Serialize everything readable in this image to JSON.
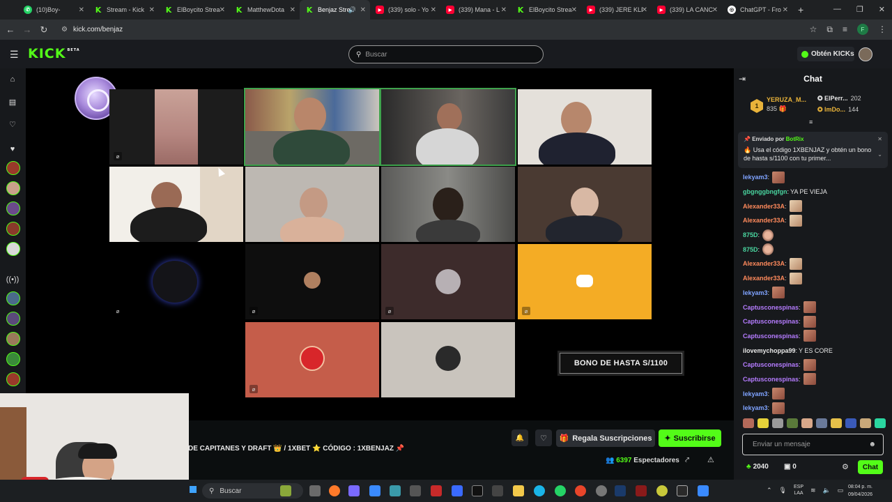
{
  "browser": {
    "tabs": [
      {
        "title": "(10)Boy-",
        "favicon": "whatsapp-icon",
        "active": false
      },
      {
        "title": "Stream - Kick",
        "favicon": "kick-icon",
        "active": false
      },
      {
        "title": "ElBoycito Strea",
        "favicon": "kick-icon",
        "active": false
      },
      {
        "title": "MatthewDota",
        "favicon": "kick-icon",
        "active": false
      },
      {
        "title": "Benjaz Stre",
        "favicon": "kick-icon",
        "active": true
      },
      {
        "title": "(339) solo - Yo",
        "favicon": "youtube-icon",
        "active": false
      },
      {
        "title": "(339) Mana - L",
        "favicon": "youtube-icon",
        "active": false
      },
      {
        "title": "ElBoycito Strea",
        "favicon": "kick-icon",
        "active": false
      },
      {
        "title": "(339) JERE KLE",
        "favicon": "youtube-icon",
        "active": false
      },
      {
        "title": "(339) LA CANC",
        "favicon": "youtube-icon",
        "active": false
      },
      {
        "title": "ChatGPT - Fro",
        "favicon": "chatgpt-icon",
        "active": false
      }
    ],
    "url": "kick.com/benjaz",
    "profile_initial": "F"
  },
  "kick": {
    "logo": "KICK",
    "logo_tag": "BETA",
    "search_placeholder": "Buscar",
    "kicks_button": "Obtén KICKs"
  },
  "stream": {
    "title": "DE CAPITANES Y DRAFT 👑 / 1XBET ⭐ CÓDIGO : 1XBENJAZ 📌",
    "overlay_banner": "BONO DE HASTA S/1100",
    "gift_button": "Regala Suscripciones",
    "subscribe_button": "Suscribirse",
    "viewers_count": "6397",
    "viewers_label": "Espectadores"
  },
  "chat": {
    "header": "Chat",
    "leaderboard": [
      {
        "rank": "1",
        "name": "YERUZA_M...",
        "points": "835"
      },
      {
        "name": "ElPerr...",
        "points": "202",
        "color": "#e8e8e8"
      },
      {
        "name": "ImDo...",
        "points": "144",
        "color": "#e9b33a"
      }
    ],
    "pinned": {
      "label": "Enviado por",
      "sender": "BotRix",
      "text": "🔥 Usa el código 1XBENJAZ y obtén un bono de hasta s/1100 con tu primer..."
    },
    "messages": [
      {
        "user": "lekyam3",
        "color": "#7fa3ff",
        "text": "",
        "emote": "face"
      },
      {
        "user": "gbgnggbngfgn",
        "color": "#4ad6a0",
        "text": "YA PE VIEJA",
        "emote": ""
      },
      {
        "user": "Alexander33A",
        "color": "#ff8a5c",
        "text": "",
        "emote": "cat"
      },
      {
        "user": "Alexander33A",
        "color": "#ff8a5c",
        "text": "",
        "emote": "cat"
      },
      {
        "user": "875D",
        "color": "#4ad6a0",
        "text": "",
        "emote": "kid"
      },
      {
        "user": "875D",
        "color": "#4ad6a0",
        "text": "",
        "emote": "kid"
      },
      {
        "user": "Alexander33A",
        "color": "#ff8a5c",
        "text": "",
        "emote": "cat"
      },
      {
        "user": "Alexander33A",
        "color": "#ff8a5c",
        "text": "",
        "emote": "cat"
      },
      {
        "user": "lekyam3",
        "color": "#7fa3ff",
        "text": "",
        "emote": "face"
      },
      {
        "user": "Captusconespinas",
        "color": "#b57cff",
        "text": "",
        "emote": "face"
      },
      {
        "user": "Captusconespinas",
        "color": "#b57cff",
        "text": "",
        "emote": "face"
      },
      {
        "user": "Captusconespinas",
        "color": "#b57cff",
        "text": "",
        "emote": "face"
      },
      {
        "user": "ilovemychoppa99",
        "color": "#e8e8e8",
        "text": "Y ES CORE",
        "emote": ""
      },
      {
        "user": "Captusconespinas",
        "color": "#b57cff",
        "text": "",
        "emote": "face"
      },
      {
        "user": "Captusconespinas",
        "color": "#b57cff",
        "text": "",
        "emote": "face"
      },
      {
        "user": "lekyam3",
        "color": "#7fa3ff",
        "text": "",
        "emote": "face"
      },
      {
        "user": "lekyam3",
        "color": "#7fa3ff",
        "text": "",
        "emote": "face"
      }
    ],
    "input_placeholder": "Enviar un mensaje",
    "kicks_balance": "2040",
    "subs_balance": "0",
    "send_button": "Chat"
  },
  "taskbar": {
    "search_placeholder": "Buscar",
    "lang_top": "ESP",
    "lang_bottom": "LAA",
    "time": "08:04 p. m.",
    "date": "09/04/2026"
  },
  "colors": {
    "kick_green": "#53fc18",
    "background": "#0b0e0f",
    "panel": "#17191c"
  }
}
